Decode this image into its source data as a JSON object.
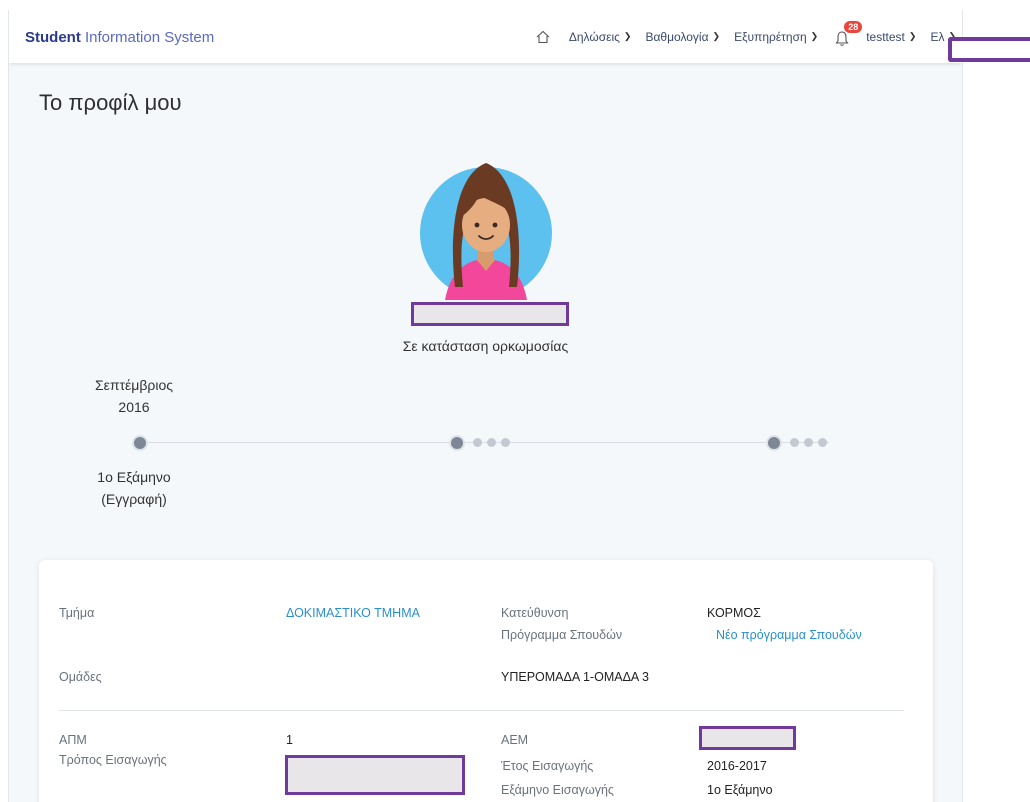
{
  "header": {
    "brand_bold": "Student",
    "brand_rest": " Information System",
    "nav": [
      {
        "label": "Δηλώσεις"
      },
      {
        "label": "Βαθμολογία"
      },
      {
        "label": "Εξυπηρέτηση"
      }
    ],
    "notifications_count": "28",
    "user": "testtest",
    "language": "Ελ"
  },
  "page": {
    "title": "Το προφίλ μου",
    "status": "Σε κατάσταση ορκωμοσίας"
  },
  "timeline": {
    "start_date_line1": "Σεπτέμβριος",
    "start_date_line2": "2016",
    "start_label_line1": "1ο Εξάμηνο",
    "start_label_line2": "(Εγγραφή)"
  },
  "details": {
    "department_label": "Τμήμα",
    "department_value": "ΔΟΚΙΜΑΣΤΙΚΟ ΤΜΗΜΑ",
    "direction_label": "Κατεύθυνση",
    "direction_value": "ΚΟΡΜΟΣ",
    "program_label": "Πρόγραμμα Σπουδών",
    "program_value": "Νέο πρόγραμμα Σπουδών",
    "groups_label": "Ομάδες",
    "groups_value": "ΥΠΕΡΟΜΑΔΑ 1-ΟΜΑΔΑ 3",
    "apm_label": "ΑΠΜ",
    "apm_value": "1",
    "entry_mode_label": "Τρόπος Εισαγωγής",
    "aem_label": "ΑΕΜ",
    "entry_year_label": "Έτος Εισαγωγής",
    "entry_year_value": "2016-2017",
    "entry_semester_label": "Εξάμηνο Εισαγωγής",
    "entry_semester_value": "1ο Εξάμηνο"
  },
  "colors": {
    "brand": "#2b3a8e",
    "link": "#2a8fd0",
    "redaction_border": "#6f3a9c",
    "badge": "#e8453c"
  }
}
